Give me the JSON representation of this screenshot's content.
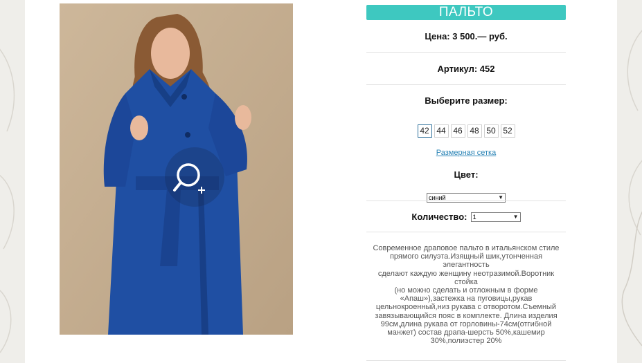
{
  "product": {
    "title": "ПАЛЬТО",
    "price": "Цена: 3 500.— руб.",
    "article": "Артикул: 452",
    "size_label": "Выберите размер:",
    "sizes": [
      "42",
      "44",
      "46",
      "48",
      "50",
      "52"
    ],
    "selected_size": "42",
    "size_chart_link": "Размерная сетка",
    "color_label": "Цвет:",
    "color_value": "синий",
    "quantity_label": "Количество:",
    "quantity_value": "1",
    "description_lines": [
      "Современное драповое пальто в итальянском стиле",
      "прямого силуэта.Изящный шик,утонченная элегантность",
      "сделают каждую женщину неотразимой.Воротник стойка",
      "(но можно сделать и отложным в форме",
      "«Апаш»),застежка на пуговицы,рукав",
      "цельнокроенный,низ рукава с отворотом.Съемный",
      "завязывающийся пояс в комплекте. Длина изделия",
      "99см,длина рукава от горловины-74см(отгибной",
      "манжет) состав драпа-шерсть 50%,кашемир",
      "30%,полиэстер 20%"
    ]
  },
  "colors": {
    "accent": "#3ec8c0",
    "link": "#2a84b6",
    "coat": "#1f4fa3"
  },
  "icons": {
    "zoom": "zoom-in-icon"
  }
}
